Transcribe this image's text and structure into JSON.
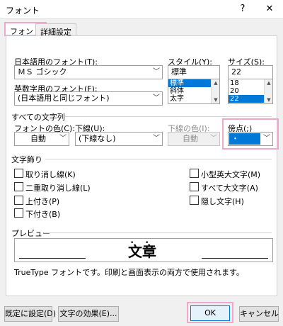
{
  "window": {
    "title": "フォント",
    "help_label": "?",
    "close_label": "✕"
  },
  "tabs": [
    {
      "label": "フォント",
      "active": true
    },
    {
      "label": "詳細設定",
      "active": false
    }
  ],
  "japanese_font": {
    "label": "日本語用のフォント(T):",
    "value": "ＭＳ ゴシック"
  },
  "western_font": {
    "label": "英数字用のフォント(F):",
    "value": "(日本語用と同じフォント)"
  },
  "style": {
    "label": "スタイル(Y):",
    "value": "標準",
    "options": [
      "標準",
      "斜体",
      "太字"
    ],
    "selected_index": 0
  },
  "size": {
    "label": "サイズ(S):",
    "value": "22",
    "options": [
      "18",
      "20",
      "22"
    ],
    "selected_index": 2
  },
  "all_text": {
    "group_label": "すべての文字列",
    "font_color_label": "フォントの色(C):",
    "font_color_value": "自動",
    "underline_label": "下線(U):",
    "underline_value": "(下線なし)",
    "underline_color_label": "下線の色(I):",
    "underline_color_value": "自動",
    "emphasis_label": "傍点(;)",
    "emphasis_value": "・"
  },
  "effects": {
    "group_label": "文字飾り",
    "left": [
      {
        "label": "取り消し線(K)"
      },
      {
        "label": "二重取り消し線(L)"
      },
      {
        "label": "上付き(P)"
      },
      {
        "label": "下付き(B)"
      }
    ],
    "right": [
      {
        "label": "小型英大文字(M)"
      },
      {
        "label": "すべて大文字(A)"
      },
      {
        "label": "隠し文字(H)"
      }
    ]
  },
  "preview": {
    "group_label": "プレビュー",
    "text": "文章",
    "description": "TrueType フォントです。印刷と画面表示の両方で使用されます。"
  },
  "buttons": {
    "default": "既定に設定(D)",
    "text_effects": "文字の効果(E)...",
    "ok": "OK",
    "cancel": "キャンセル"
  },
  "colors": {
    "highlight": "#f0a8c8",
    "selection": "#0078d7"
  }
}
